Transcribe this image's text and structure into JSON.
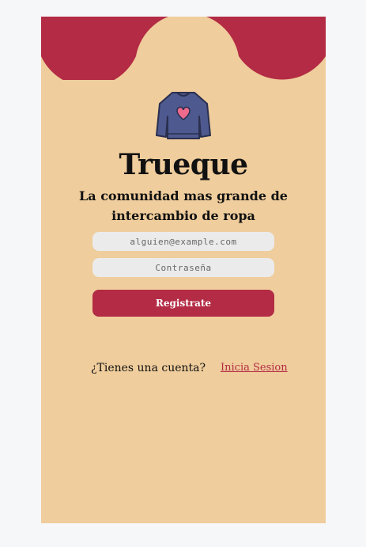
{
  "app": {
    "title": "Trueque",
    "subtitle": "La comunidad mas grande de intercambio de ropa"
  },
  "form": {
    "email_placeholder": "alguien@example.com",
    "password_placeholder": "Contraseña",
    "submit_label": "Registrate"
  },
  "footer": {
    "prompt": "¿Tienes una cuenta?",
    "login_link": "Inicia Sesion"
  },
  "icons": {
    "logo": "sweater-heart-icon"
  },
  "colors": {
    "background": "#efcd9c",
    "accent": "#b32b44",
    "input_bg": "#ebebeb"
  }
}
